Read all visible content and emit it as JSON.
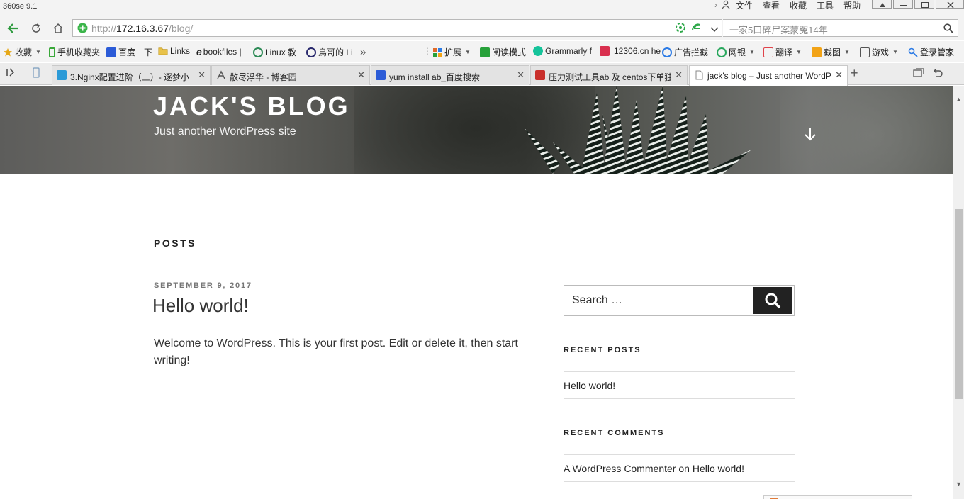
{
  "window": {
    "app_title": "360se 9.1",
    "menu": [
      "文件",
      "查看",
      "收藏",
      "工具",
      "帮助"
    ]
  },
  "toolbar": {
    "url_scheme": "http://",
    "url_host": "172.16.3.67",
    "url_path": "/blog/",
    "search_placeholder": "一家5口碎尸案蒙冤14年"
  },
  "bookmarks": [
    {
      "label": "收藏",
      "icon": "star-icon",
      "color": "#e6a817"
    },
    {
      "label": "手机收藏夹",
      "icon": "phone-icon",
      "color": "#3aa83a"
    },
    {
      "label": "百度一下",
      "icon": "baidu-paw-icon",
      "color": "#2b5bd7"
    },
    {
      "label": "Links",
      "icon": "folder-icon",
      "color": "#e8c24a"
    },
    {
      "label": "bookfiles |",
      "icon": "e-icon",
      "color": "#1a1a1a"
    },
    {
      "label": "Linux 教",
      "icon": "globe-icon",
      "color": "#2e8b57"
    },
    {
      "label": "鳥哥的 Li",
      "icon": "bird-icon",
      "color": "#2a2a6e"
    },
    {
      "label": "扩展",
      "icon": "grid-icon",
      "color": "#e06b2a"
    },
    {
      "label": "阅读模式",
      "icon": "book-icon",
      "color": "#27a13a"
    },
    {
      "label": "Grammarly f",
      "icon": "grammarly-icon",
      "color": "#15c39a"
    },
    {
      "label": "12306.cn he",
      "icon": "train-icon",
      "color": "#d9304f"
    },
    {
      "label": "广告拦截",
      "icon": "block-icon",
      "color": "#2c7be5"
    },
    {
      "label": "网银",
      "icon": "yen-icon",
      "color": "#26a65b"
    },
    {
      "label": "翻译",
      "icon": "translate-icon",
      "color": "#e0434a"
    },
    {
      "label": "截图",
      "icon": "scissors-icon",
      "color": "#f2a316"
    },
    {
      "label": "游戏",
      "icon": "gamepad-icon",
      "color": "#555555"
    },
    {
      "label": "登录管家",
      "icon": "key-icon",
      "color": "#2c7be5"
    }
  ],
  "tabs": [
    {
      "label": "3.Nginx配置进阶（三）- 逐梦小",
      "icon": "site-icon",
      "color": "#2b9ad7"
    },
    {
      "label": "散尽浮华 - 博客园",
      "icon": "cnblogs-icon",
      "color": "#555555"
    },
    {
      "label": "yum install ab_百度搜索",
      "icon": "baidu-paw-icon",
      "color": "#2b5bd7"
    },
    {
      "label": "压力测试工具ab 及 centos下单独",
      "icon": "csdn-icon",
      "color": "#c9302c"
    },
    {
      "label": "jack's blog – Just another WordPress site",
      "icon": "page-icon",
      "color": "#888888"
    }
  ],
  "site": {
    "title": "JACK'S BLOG",
    "description": "Just another WordPress site"
  },
  "main": {
    "section_heading": "POSTS",
    "post": {
      "date": "SEPTEMBER 9, 2017",
      "title": "Hello world!",
      "body": "Welcome to WordPress. This is your first post. Edit or delete it, then start writing!"
    }
  },
  "sidebar": {
    "search_placeholder": "Search …",
    "recent_posts_title": "RECENT POSTS",
    "recent_posts": [
      "Hello world!"
    ],
    "recent_comments_title": "RECENT COMMENTS",
    "recent_comment": {
      "author": "A WordPress Commenter",
      "joiner": " on ",
      "post": "Hello world!"
    }
  }
}
